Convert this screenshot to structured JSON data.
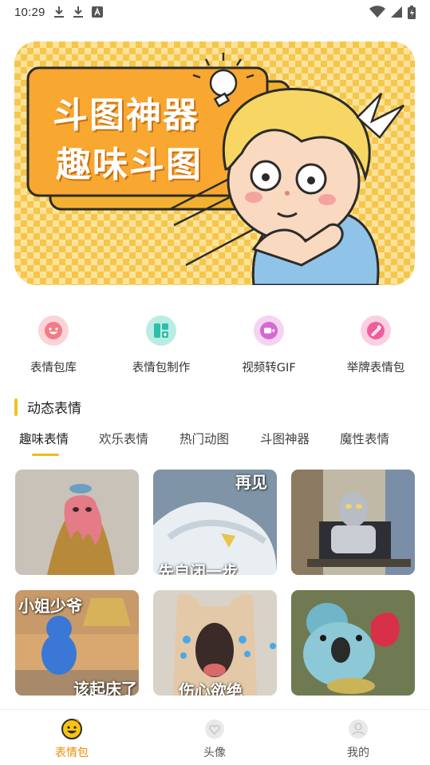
{
  "status_bar": {
    "time": "10:29",
    "icons": [
      "download-icon",
      "download-icon",
      "notification-a-icon",
      "wifi-icon",
      "signal-icon",
      "battery-charging-icon"
    ]
  },
  "banner": {
    "line1": "斗图神器",
    "line2": "趣味斗图"
  },
  "quick_entries": [
    {
      "label": "表情包库",
      "icon": "smiley-icon",
      "bg": "#fbd4d8",
      "fg": "#f57b89"
    },
    {
      "label": "表情包制作",
      "icon": "grid-make-icon",
      "bg": "#b9ede4",
      "fg": "#2dbfa8"
    },
    {
      "label": "视频转GIF",
      "icon": "video-icon",
      "bg": "#f4d4f2",
      "fg": "#d768d1"
    },
    {
      "label": "举牌表情包",
      "icon": "sign-brush-icon",
      "bg": "#fbcfe2",
      "fg": "#ee5e9d"
    }
  ],
  "section": {
    "title": "动态表情"
  },
  "tabs": [
    {
      "label": "趣味表情",
      "active": true
    },
    {
      "label": "欢乐表情",
      "active": false
    },
    {
      "label": "热门动图",
      "active": false
    },
    {
      "label": "斗图神器",
      "active": false
    },
    {
      "label": "魔性表情",
      "active": false
    }
  ],
  "tiles": [
    {
      "caption_top": "",
      "caption_bottom": ""
    },
    {
      "caption_top": "再见",
      "caption_bottom": "先自闭一步"
    },
    {
      "caption_top": "",
      "caption_bottom": ""
    },
    {
      "caption_top": "小姐少爷",
      "caption_bottom": "该起床了"
    },
    {
      "caption_top": "",
      "caption_bottom": "伤心欲绝"
    },
    {
      "caption_top": "",
      "caption_bottom": ""
    }
  ],
  "bottom_nav": [
    {
      "label": "表情包",
      "icon": "emoji-face-icon",
      "active": true
    },
    {
      "label": "头像",
      "icon": "heart-icon",
      "active": false
    },
    {
      "label": "我的",
      "icon": "user-icon",
      "active": false
    }
  ],
  "colors": {
    "accent": "#f08c0c",
    "tab_underline": "#f6b81f",
    "section_bar": "#f6c020",
    "banner_yellow": "#f6c64c"
  }
}
